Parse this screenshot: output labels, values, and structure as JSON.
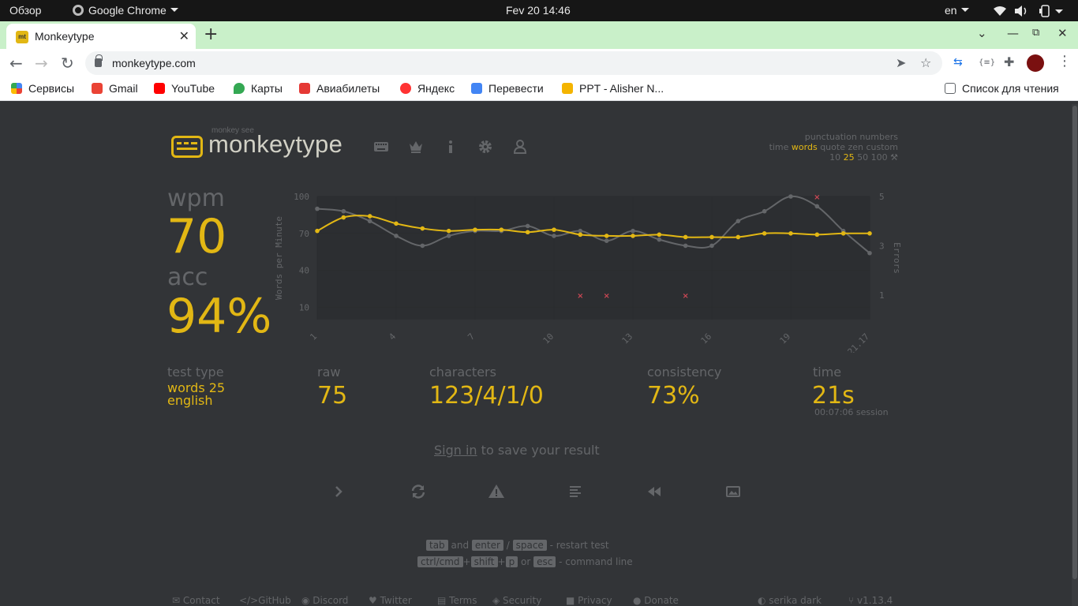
{
  "os": {
    "activities": "Обзор",
    "app": "Google Chrome",
    "clock": "Fev 20  14:46",
    "lang": "en"
  },
  "browser": {
    "tab_title": "Monkeytype",
    "url": "monkeytype.com",
    "bookmarks": [
      {
        "label": "Сервисы",
        "color": "#4285f4"
      },
      {
        "label": "Gmail",
        "color": "#ea4335"
      },
      {
        "label": "YouTube",
        "color": "#ff0000"
      },
      {
        "label": "Карты",
        "color": "#34a853"
      },
      {
        "label": "Авиабилеты",
        "color": "#e53935"
      },
      {
        "label": "Яндекс",
        "color": "#ff3333"
      },
      {
        "label": "Перевести",
        "color": "#4285f4"
      },
      {
        "label": "PPT - Alisher N...",
        "color": "#f4b400"
      }
    ],
    "reading_list": "Список для чтения"
  },
  "header": {
    "logo_small": "monkey see",
    "logo": "monkeytype",
    "modes_row1": [
      "punctuation",
      "numbers"
    ],
    "modes_row2": [
      "time",
      "words",
      "quote",
      "zen",
      "custom"
    ],
    "modes_row2_active": "words",
    "counts": [
      "10",
      "25",
      "50",
      "100"
    ],
    "counts_active": "25"
  },
  "result": {
    "wpm_label": "wpm",
    "wpm": "70",
    "acc_label": "acc",
    "acc": "94%",
    "test_type_label": "test type",
    "test_type_line1": "words 25",
    "test_type_line2": "english",
    "raw_label": "raw",
    "raw": "75",
    "characters_label": "characters",
    "characters": "123/4/1/0",
    "consistency_label": "consistency",
    "consistency": "73%",
    "time_label": "time",
    "time": "21s",
    "session": "00:07:06 session"
  },
  "signin": {
    "link": "Sign in",
    "rest": " to save your result"
  },
  "hints": {
    "line1": [
      {
        "k": "tab"
      },
      {
        "t": " and "
      },
      {
        "k": "enter"
      },
      {
        "t": " / "
      },
      {
        "k": "space"
      },
      {
        "t": " - restart test"
      }
    ],
    "line2": [
      {
        "k": "ctrl/cmd"
      },
      {
        "t": "+"
      },
      {
        "k": "shift"
      },
      {
        "t": "+"
      },
      {
        "k": "p"
      },
      {
        "t": " or "
      },
      {
        "k": "esc"
      },
      {
        "t": " - command line"
      }
    ]
  },
  "footer": {
    "left": [
      "Contact",
      "GitHub",
      "Discord",
      "Twitter",
      "Terms",
      "Security",
      "Privacy",
      "Donate"
    ],
    "theme": "serika dark",
    "version": "v1.13.4"
  },
  "colors": {
    "bg": "#323437",
    "main": "#e2b714",
    "sub": "#646669",
    "text": "#d1d0c5",
    "error": "#ca4754"
  },
  "chart_data": {
    "type": "line",
    "x_ticks": [
      "1",
      "4",
      "7",
      "10",
      "13",
      "16",
      "19",
      "21.17"
    ],
    "x": [
      1,
      2,
      3,
      4,
      5,
      6,
      7,
      8,
      9,
      10,
      11,
      12,
      13,
      14,
      15,
      16,
      17,
      18,
      19,
      20,
      21,
      21.17
    ],
    "ylabel": "Words per Minute",
    "y_ticks": [
      100,
      70,
      40,
      10
    ],
    "ylim": [
      0,
      100
    ],
    "y2label": "Errors",
    "y2_ticks": [
      5,
      3,
      1
    ],
    "y2lim": [
      0,
      5
    ],
    "series": [
      {
        "name": "wpm",
        "color": "#e2b714",
        "values": [
          72,
          83,
          84,
          78,
          74,
          72,
          73,
          73,
          71,
          73,
          69,
          68,
          68,
          69,
          67,
          67,
          67,
          70,
          70,
          69,
          70,
          70
        ]
      },
      {
        "name": "raw",
        "color": "#646669",
        "values": [
          90,
          88,
          80,
          68,
          60,
          68,
          72,
          72,
          76,
          68,
          72,
          64,
          72,
          65,
          60,
          60,
          80,
          88,
          100,
          92,
          72,
          54
        ]
      },
      {
        "name": "errors",
        "color": "#ca4754",
        "points": [
          [
            11,
            1
          ],
          [
            12,
            1
          ],
          [
            15,
            1
          ],
          [
            20,
            5
          ]
        ]
      }
    ]
  }
}
